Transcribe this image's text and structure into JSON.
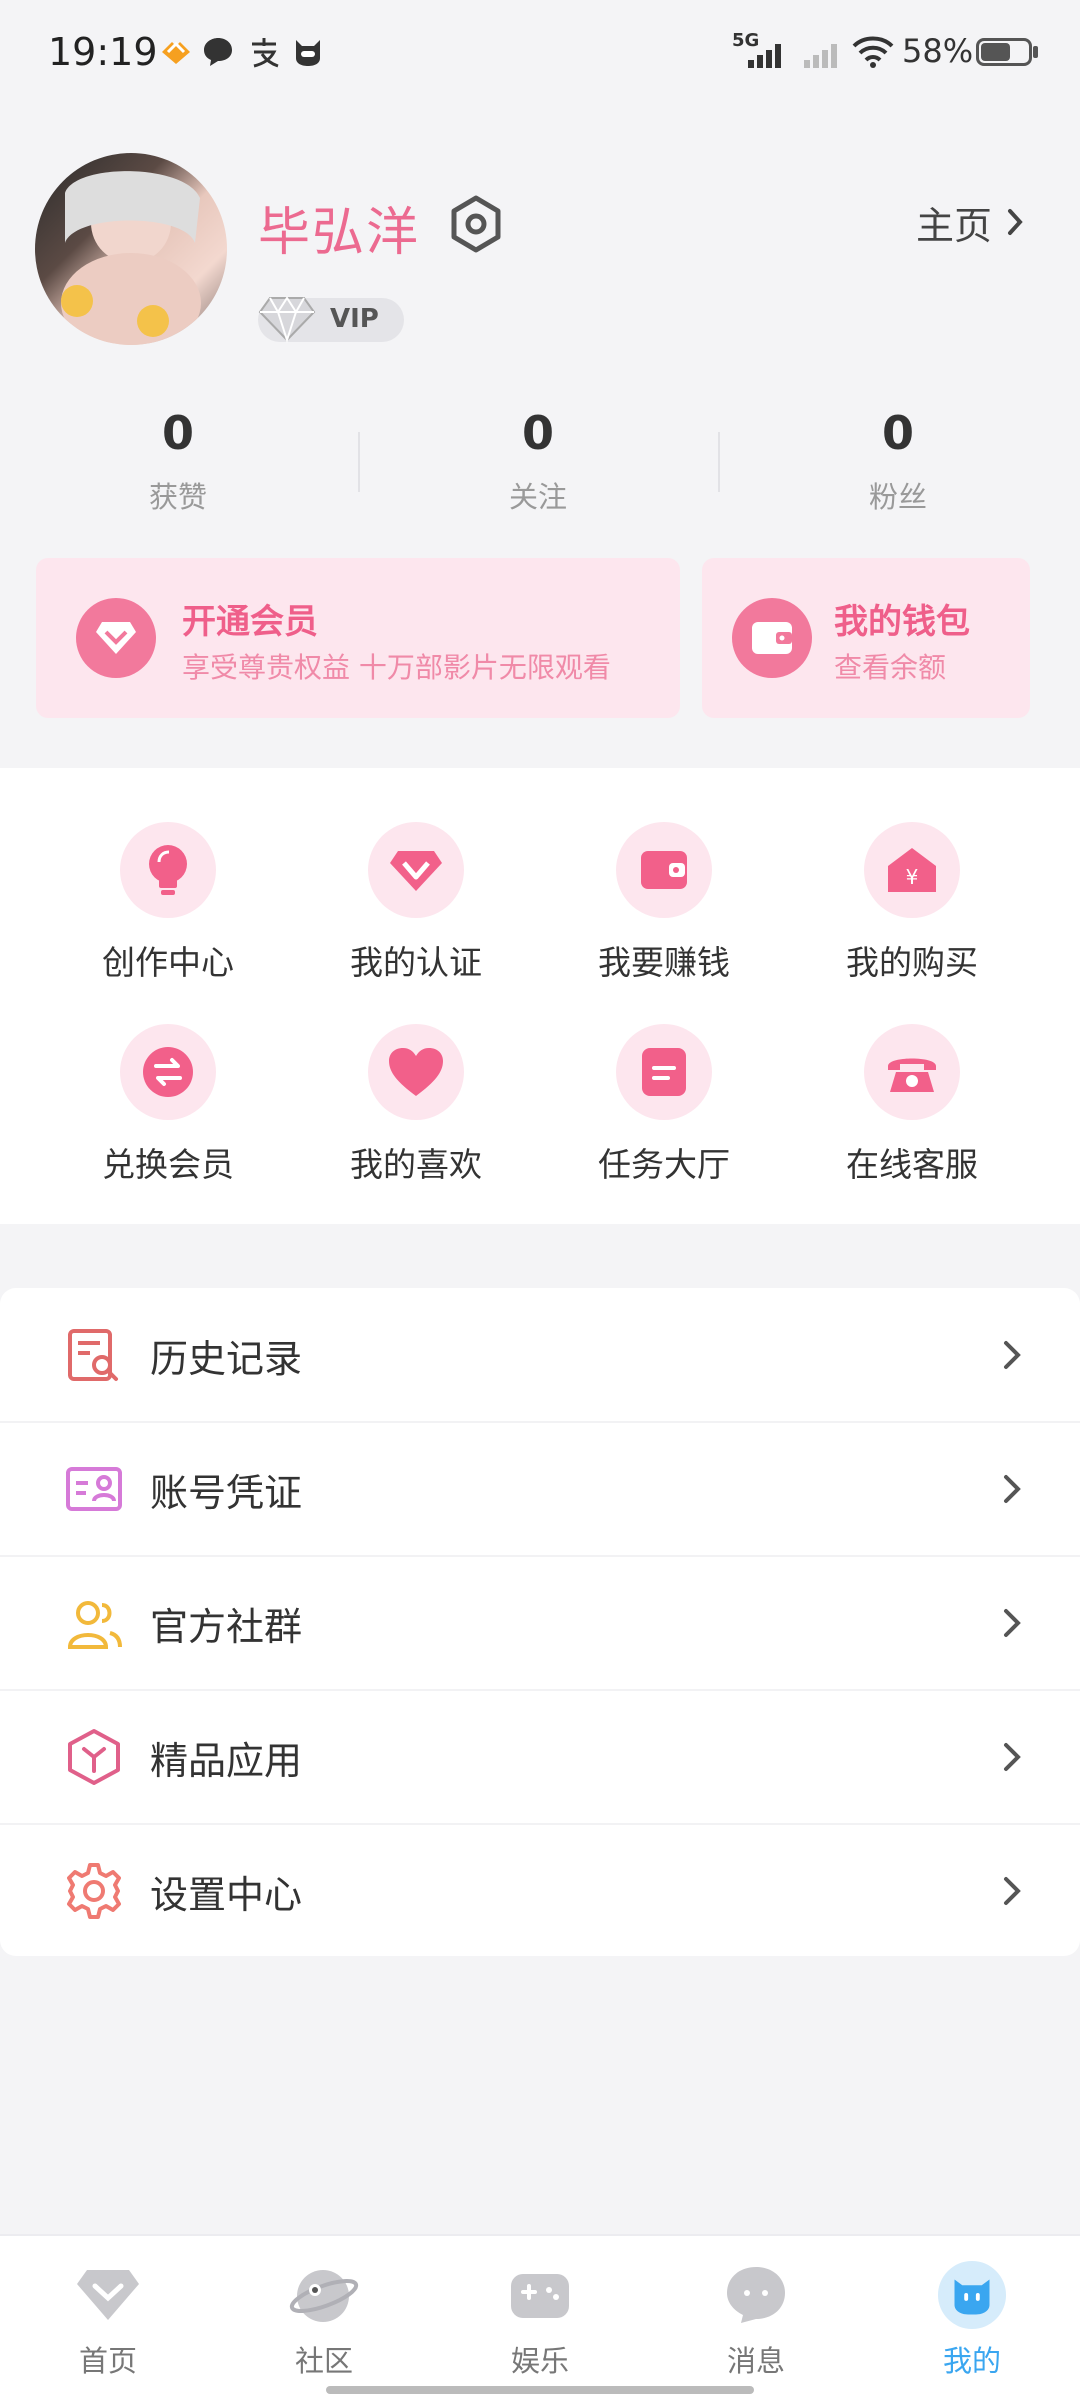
{
  "status_bar": {
    "time": "19:19",
    "network": "5G",
    "battery_pct": "58%",
    "battery_level": 0.58,
    "icons": [
      "heart-icon",
      "chat-bubble-icon",
      "alipay-icon",
      "cat-face-icon",
      "signal-icon",
      "signal-weak-icon",
      "wifi-icon",
      "battery-icon"
    ]
  },
  "profile": {
    "username": "毕弘洋",
    "vip_label": "VIP",
    "homepage_label": "主页"
  },
  "stats": [
    {
      "value": "0",
      "label": "获赞"
    },
    {
      "value": "0",
      "label": "关注"
    },
    {
      "value": "0",
      "label": "粉丝"
    }
  ],
  "cards": {
    "membership": {
      "title": "开通会员",
      "subtitle": "享受尊贵权益 十万部影片无限观看",
      "icon": "diamond-icon"
    },
    "wallet": {
      "title": "我的钱包",
      "subtitle": "查看余额",
      "icon": "wallet-icon"
    }
  },
  "grid": [
    {
      "label": "创作中心",
      "icon": "lightbulb-icon"
    },
    {
      "label": "我的认证",
      "icon": "vip-diamond-icon"
    },
    {
      "label": "我要赚钱",
      "icon": "wallet-icon"
    },
    {
      "label": "我的购买",
      "icon": "shop-icon"
    },
    {
      "label": "兑换会员",
      "icon": "exchange-icon"
    },
    {
      "label": "我的喜欢",
      "icon": "heart-icon"
    },
    {
      "label": "任务大厅",
      "icon": "task-icon"
    },
    {
      "label": "在线客服",
      "icon": "phone-icon"
    }
  ],
  "menu": [
    {
      "label": "历史记录",
      "icon": "history-icon"
    },
    {
      "label": "账号凭证",
      "icon": "id-card-icon"
    },
    {
      "label": "官方社群",
      "icon": "group-icon"
    },
    {
      "label": "精品应用",
      "icon": "app-box-icon"
    },
    {
      "label": "设置中心",
      "icon": "settings-gear-icon"
    }
  ],
  "bottom_nav": [
    {
      "label": "首页",
      "icon": "home-diamond-icon",
      "active": false
    },
    {
      "label": "社区",
      "icon": "planet-icon",
      "active": false
    },
    {
      "label": "娱乐",
      "icon": "gamepad-icon",
      "active": false
    },
    {
      "label": "消息",
      "icon": "message-icon",
      "active": false
    },
    {
      "label": "我的",
      "icon": "profile-cat-icon",
      "active": true
    }
  ],
  "colors": {
    "accent": "#ec6a90",
    "card_bg": "#fde6ee",
    "nav_active": "#3aa6f0",
    "nav_inactive": "#777777"
  }
}
